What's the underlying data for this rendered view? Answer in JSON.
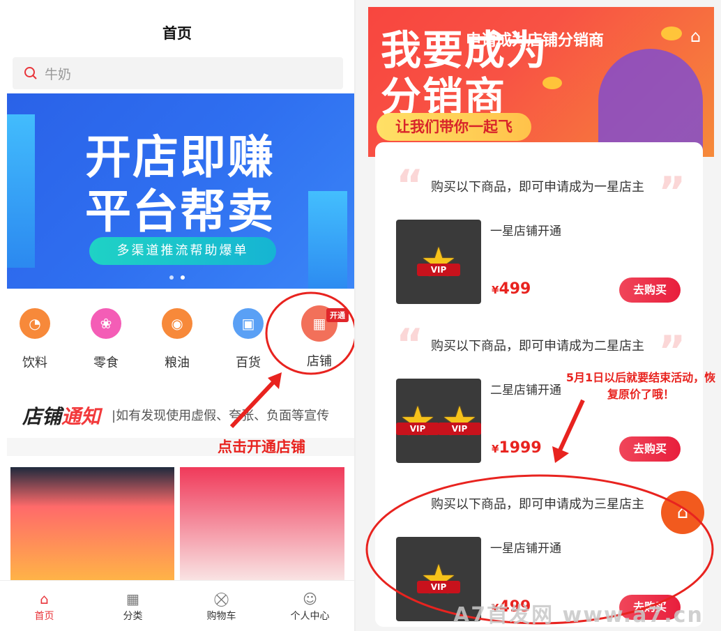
{
  "left": {
    "title": "首页",
    "search_placeholder": "牛奶",
    "banner": {
      "line1": "开店即赚",
      "line2": "平台帮卖",
      "sub": "多渠道推流帮助爆单"
    },
    "categories": [
      {
        "label": "饮料",
        "icon": "drink-icon",
        "color": "#f7893a"
      },
      {
        "label": "零食",
        "icon": "snack-icon",
        "color": "#f45db6"
      },
      {
        "label": "粮油",
        "icon": "grain-icon",
        "color": "#f7893a"
      },
      {
        "label": "百货",
        "icon": "bag-icon",
        "color": "#5aa0f5"
      },
      {
        "label": "店铺",
        "icon": "shop-icon",
        "color": "#f2705a"
      }
    ],
    "badge": "开通",
    "notice": {
      "h_prefix": "店铺",
      "h_suffix": "通知",
      "text": "|如有发现使用虚假、夸张、负面等宣传"
    },
    "annotation": "点击开通店铺",
    "tabs": [
      {
        "label": "首页",
        "icon": "home-icon",
        "active": true
      },
      {
        "label": "分类",
        "icon": "grid-icon",
        "active": false
      },
      {
        "label": "购物车",
        "icon": "cart-icon",
        "active": false
      },
      {
        "label": "个人中心",
        "icon": "user-icon",
        "active": false
      }
    ]
  },
  "right": {
    "banner": {
      "big1": "我要成为",
      "big2": "分销商",
      "overlay": "申请成为店铺分销商",
      "slogan": "让我们带你一起飞"
    },
    "sections": [
      {
        "title": "购买以下商品，即可申请成为一星店主",
        "product": "一星店铺开通",
        "currency": "¥",
        "price": "499",
        "button": "去购买",
        "stars": 1
      },
      {
        "title": "购买以下商品，即可申请成为二星店主",
        "product": "二星店铺开通",
        "currency": "¥",
        "price": "1999",
        "button": "去购买",
        "stars": 2
      },
      {
        "title": "购买以下商品，即可申请成为三星店主",
        "product": "一星店铺开通",
        "currency": "¥",
        "price": "499",
        "button": "去购买",
        "stars": 1
      }
    ],
    "vip": "VIP",
    "annotation": "5月1日以后就要结束活动，恢复原价了哦！",
    "watermark": "A7首发网    www.a7.cn"
  }
}
